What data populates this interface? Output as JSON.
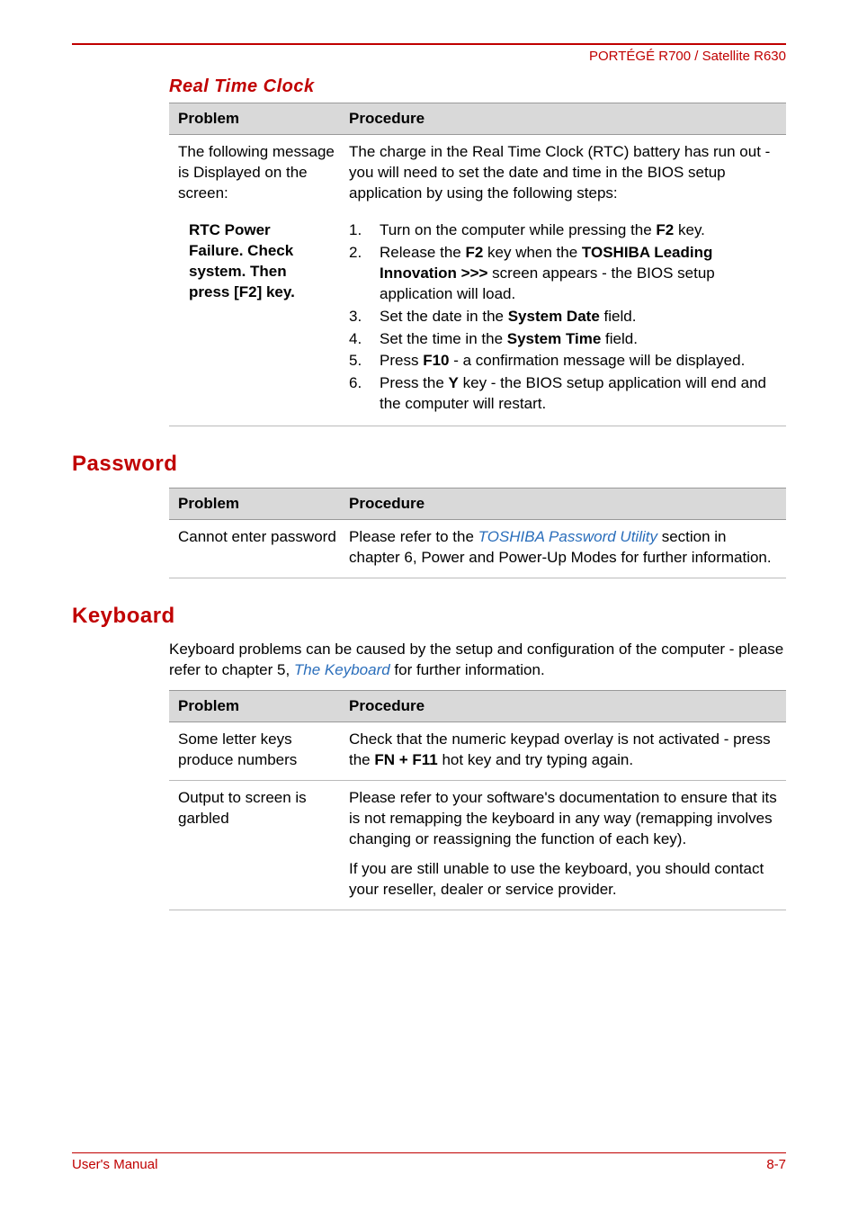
{
  "header": {
    "product_line": "PORTÉGÉ R700 / Satellite R630"
  },
  "sections": {
    "rtc": {
      "title": "Real Time Clock",
      "col_problem": "Problem",
      "col_procedure": "Procedure",
      "row1_problem": "The following message is Displayed on the screen:",
      "row1_procedure": "The charge in the Real Time Clock (RTC) battery has run out - you will need to set the date and time in the BIOS setup application by using the following steps:",
      "row2_problem_l1": "RTC Power",
      "row2_problem_l2": "Failure. Check",
      "row2_problem_l3": "system. Then",
      "row2_problem_l4": "press [F2] key.",
      "step1_a": "Turn on the computer while pressing the ",
      "step1_b": "F2",
      "step1_c": " key.",
      "step2_a": "Release the ",
      "step2_b": "F2",
      "step2_c": " key when the ",
      "step2_d": "TOSHIBA Leading Innovation >>>",
      "step2_e": " screen appears - the BIOS setup application will load.",
      "step3_a": "Set the date in the ",
      "step3_b": "System Date",
      "step3_c": " field.",
      "step4_a": "Set the time in the ",
      "step4_b": "System Time",
      "step4_c": " field.",
      "step5_a": "Press ",
      "step5_b": "F10",
      "step5_c": " - a confirmation message will be displayed.",
      "step6_a": "Press the ",
      "step6_b": "Y",
      "step6_c": " key - the BIOS setup application will end and the computer will restart."
    },
    "password": {
      "title": "Password",
      "col_problem": "Problem",
      "col_procedure": "Procedure",
      "row1_problem": "Cannot enter password",
      "row1_proc_a": "Please refer to the ",
      "row1_proc_link": "TOSHIBA Password Utility",
      "row1_proc_b": " section in chapter 6, Power and Power-Up Modes for further information."
    },
    "keyboard": {
      "title": "Keyboard",
      "intro_a": "Keyboard problems can be caused by the setup and configuration of the computer - please refer to chapter 5, ",
      "intro_link": "The Keyboard",
      "intro_b": " for further information.",
      "col_problem": "Problem",
      "col_procedure": "Procedure",
      "row1_problem": "Some letter keys produce numbers",
      "row1_proc_a": "Check that the numeric keypad overlay is not activated - press the ",
      "row1_proc_b": "FN + F11",
      "row1_proc_c": " hot key and try typing again.",
      "row2_problem": "Output to screen is garbled",
      "row2_proc_p1": "Please refer to your software's documentation to ensure that its is not remapping the keyboard in any way (remapping involves changing or reassigning the function of each key).",
      "row2_proc_p2": "If you are still unable to use the keyboard, you should contact your reseller, dealer or service provider."
    }
  },
  "footer": {
    "left": "User's Manual",
    "right": "8-7"
  }
}
